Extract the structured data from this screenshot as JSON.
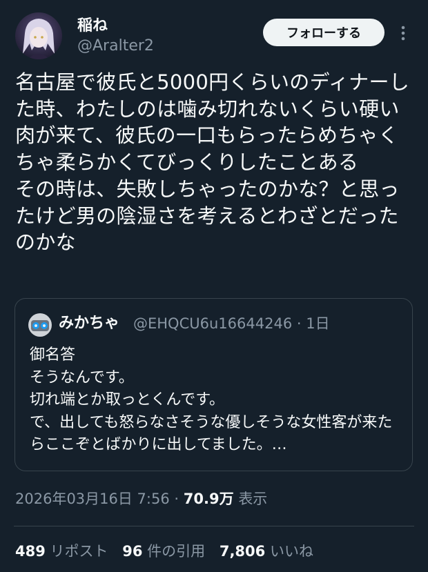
{
  "author": {
    "display_name": "稲ね",
    "handle": "@Aralter2"
  },
  "follow_button_label": "フォローする",
  "tweet": {
    "text": "名古屋で彼氏と5000円くらいのディナーした時、わたしのは噛み切れないくらい硬い肉が来て、彼氏の一口もらったらめちゃくちゃ柔らかくてびっくりしたことある\nその時は、失敗しちゃったのかな？と思ったけど男の陰湿さを考えるとわざとだったのかな"
  },
  "quote": {
    "display_name": "みかちゃ",
    "handle": "@EHQCU6u16644246",
    "separator": "·",
    "time": "1日",
    "text": "御名答\nそうなんです。\n切れ端とか取っとくんです。\nで、出しても怒らなさそうな優しそうな女性客が来たらここぞとばかりに出してました。…"
  },
  "meta": {
    "timestamp": "2026年03月16日 7:56",
    "separator": "·",
    "views_count": "70.9万",
    "views_label": "表示"
  },
  "stats": {
    "reposts_count": "489",
    "reposts_label": "リポスト",
    "quotes_count": "96",
    "quotes_label": "件の引用",
    "likes_count": "7,806",
    "likes_label": "いいね"
  },
  "colors": {
    "background": "#15202b",
    "text_primary": "#f7f9f9",
    "text_secondary": "#8b98a5",
    "border": "#38444d",
    "follow_button_bg": "#eff3f4"
  },
  "icons": {
    "more": "more-vertical-icon"
  }
}
